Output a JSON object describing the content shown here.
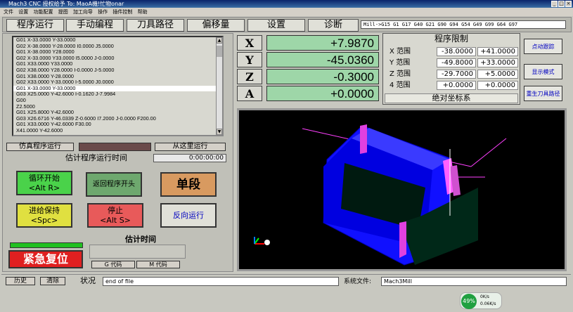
{
  "titlebar": {
    "title": "Mach3 CNC  授权给予 To: MaoA機!忙物onar"
  },
  "menu": [
    "文件",
    "设置",
    "功能配置",
    "提图",
    "加工向导",
    "操作",
    "插件控制",
    "帮助"
  ],
  "tabs": [
    "程序运行",
    "手动编程",
    "刀具路径",
    "偏移量",
    "设置",
    "诊断"
  ],
  "modal_codes": "Mill->G15  G1 G17 G40 G21 G90 G94 G54 G49 G99 G64 G97",
  "gcode_lines": [
    "G01 X-33.0000 Y-33.0000",
    "G02 X-38.0000 Y-28.0000 I0.0000 J5.0000",
    "G01 X-38.0000 Y28.0000",
    "G02 X-33.0000 Y33.0000 I5.0000 J-0.0000",
    "G01 X33.0000 Y33.0000",
    "G02 X38.0000 Y28.0000 I-0.0000 J-5.0000",
    "G01 X38.0000 Y-28.0000",
    "G02 X33.0000 Y-33.0000 I-5.0000 J0.0000",
    "G01 X-33.0000 Y-33.0000",
    "G03 X25.0000 Y-42.6000 I-0.1620 J-7.9984",
    "G00",
    "Z2.5000",
    "G01 X25.8000 Y-42.6000",
    "G03 X26.6716 Y-46.0339 Z-0.6000 I7.2000 J-0.0000 F200.00",
    "G01 X33.0000 Y-42.6000 F30.00",
    "X41.0000 Y-42.6000"
  ],
  "selected_line_index": 8,
  "controls": {
    "simulate": "仿真程序运行",
    "run_from_here": "从这里运行",
    "estimate_label": "估计程序运行时间",
    "estimate_value": "0:00:00:00",
    "cycle_start": "循环开始",
    "cycle_start_key": "<Alt R>",
    "rewind": "返回程序开头",
    "single_block": "单段",
    "feed_hold": "进给保持",
    "feed_hold_key": "<Spc>",
    "stop": "停止",
    "stop_key": "<Alt S>",
    "reverse_run": "反向运行",
    "estop": "紧急复位",
    "estimate_time_label": "估计时间",
    "g_codes": "G 代码",
    "m_codes": "M 代码"
  },
  "axes": [
    {
      "letter": "X",
      "value": "+7.9870"
    },
    {
      "letter": "Y",
      "value": "-45.0360"
    },
    {
      "letter": "Z",
      "value": "-0.3000"
    },
    {
      "letter": "A",
      "value": "+0.0000"
    }
  ],
  "limits": {
    "title": "程序限制",
    "rows": [
      {
        "label": "X 范围",
        "min": "-38.0000",
        "max": "+41.0000"
      },
      {
        "label": "Y 范围",
        "min": "-49.8000",
        "max": "+33.0000"
      },
      {
        "label": "Z 范围",
        "min": "-29.7000",
        "max": "+5.0000"
      },
      {
        "label": "4 范围",
        "min": "+0.0000",
        "max": "+0.0000"
      }
    ],
    "coord_mode": "绝对坐标系"
  },
  "side_buttons": [
    "点动跟踪",
    "显示模式",
    "重生刀具路径"
  ],
  "bottom": {
    "history": "历史",
    "clear": "清除",
    "status_label": "状况",
    "status_value": "end of file",
    "system_file_label": "系统文件:",
    "system_file_value": "Mach3Mill",
    "progress_percent": "49%",
    "speed1": "0K/s",
    "speed2": "0.06K/s"
  },
  "colors": {
    "dro_green": "#9ed6a8",
    "cycle_start": "#4ad24a",
    "stop": "#e85a5a",
    "estop": "#e02020",
    "viewport_part": "#1010ff"
  }
}
